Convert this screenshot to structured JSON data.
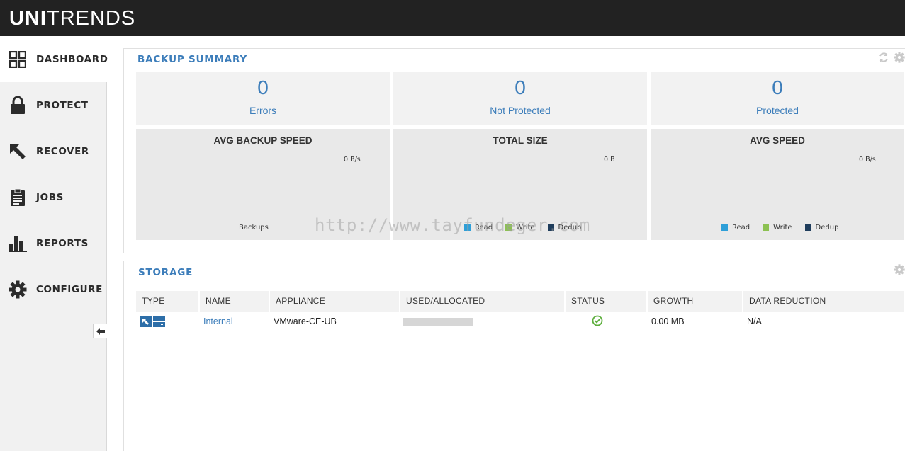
{
  "header": {
    "logo_bold": "UNI",
    "logo_thin": "TRENDS"
  },
  "sidebar": {
    "items": [
      {
        "label": "DASHBOARD",
        "icon": "dashboard-grid-icon"
      },
      {
        "label": "PROTECT",
        "icon": "lock-icon"
      },
      {
        "label": "RECOVER",
        "icon": "recover-arrow-icon"
      },
      {
        "label": "JOBS",
        "icon": "clipboard-icon"
      },
      {
        "label": "REPORTS",
        "icon": "bar-chart-icon"
      },
      {
        "label": "CONFIGURE",
        "icon": "gear-icon"
      }
    ]
  },
  "backup_summary": {
    "title": "BACKUP SUMMARY",
    "stats": [
      {
        "value": "0",
        "label": "Errors"
      },
      {
        "value": "0",
        "label": "Not Protected"
      },
      {
        "value": "0",
        "label": "Protected"
      }
    ],
    "charts": [
      {
        "title": "AVG BACKUP SPEED",
        "value": "0 B/s",
        "caption": "Backups"
      },
      {
        "title": "TOTAL SIZE",
        "value": "0 B",
        "legend": [
          "Read",
          "Write",
          "Dedup"
        ]
      },
      {
        "title": "AVG SPEED",
        "value": "0 B/s",
        "legend": [
          "Read",
          "Write",
          "Dedup"
        ]
      }
    ]
  },
  "storage": {
    "title": "STORAGE",
    "columns": [
      "TYPE",
      "NAME",
      "APPLIANCE",
      "USED/ALLOCATED",
      "STATUS",
      "GROWTH",
      "DATA REDUCTION"
    ],
    "rows": [
      {
        "name": "Internal",
        "appliance": "VMware-CE-UB",
        "growth": "0.00 MB",
        "data_reduction": "N/A"
      }
    ]
  },
  "watermark": "http://www.tayfundeger.com",
  "colors": {
    "accent": "#3c7dba",
    "read": "#2e9fd8",
    "write": "#8cc152",
    "dedup": "#1f3d5c",
    "status_ok": "#5cae3c"
  }
}
